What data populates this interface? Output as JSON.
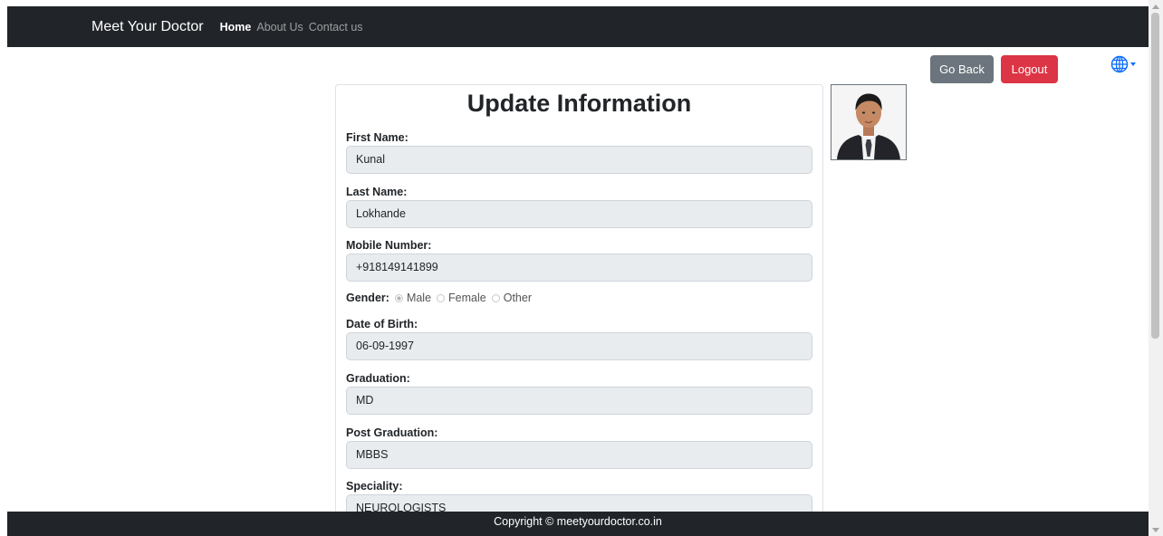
{
  "navbar": {
    "brand": "Meet Your Doctor",
    "links": [
      "Home",
      "About Us",
      "Contact us"
    ]
  },
  "actions": {
    "go_back": "Go Back",
    "logout": "Logout"
  },
  "language_icon": "globe-icon",
  "form": {
    "title": "Update Information",
    "first_name": {
      "label": "First Name:",
      "value": "Kunal"
    },
    "last_name": {
      "label": "Last Name:",
      "value": "Lokhande"
    },
    "mobile": {
      "label": "Mobile Number:",
      "value": "+918149141899"
    },
    "gender": {
      "label": "Gender:",
      "options": [
        "Male",
        "Female",
        "Other"
      ],
      "selected": "Male"
    },
    "dob": {
      "label": "Date of Birth:",
      "value": "06-09-1997"
    },
    "graduation": {
      "label": "Graduation:",
      "value": "MD"
    },
    "post_graduation": {
      "label": "Post Graduation:",
      "value": "MBBS"
    },
    "speciality": {
      "label": "Speciality:",
      "value": "NEUROLOGISTS"
    }
  },
  "footer": {
    "text": "Copyright © meetyourdoctor.co.in"
  },
  "colors": {
    "navbar": "#212529",
    "go_back": "#6c757d",
    "logout": "#dc3545",
    "accent": "#0d6efd",
    "field_bg": "#e9ecef"
  }
}
